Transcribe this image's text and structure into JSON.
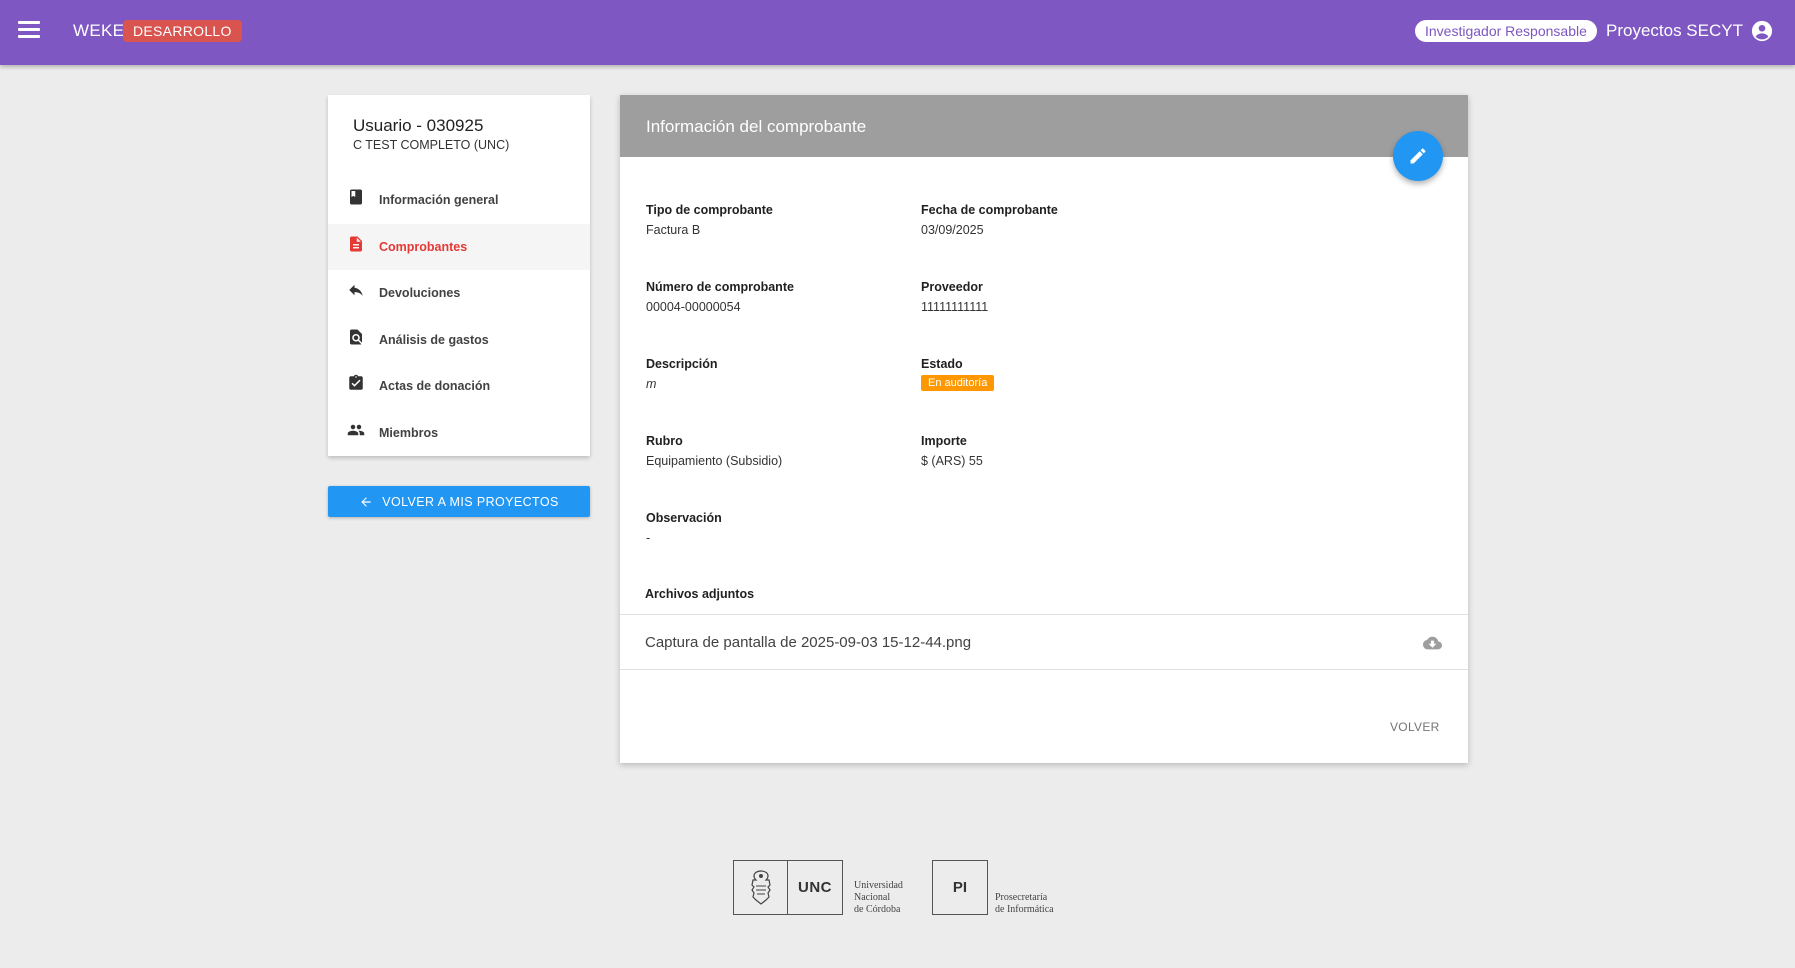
{
  "topbar": {
    "brand": "WEKE",
    "env_badge": "DESARROLLO",
    "role": "Investigador Responsable",
    "app_name": "Proyectos SECYT",
    "color": "#7e57c2"
  },
  "sidebar": {
    "title": "Usuario - 030925",
    "subtitle": "C TEST COMPLETO (UNC)",
    "items": [
      {
        "label": "Información general",
        "icon": "book-icon"
      },
      {
        "label": "Comprobantes",
        "icon": "document-icon",
        "active": true
      },
      {
        "label": "Devoluciones",
        "icon": "reply-icon"
      },
      {
        "label": "Análisis de gastos",
        "icon": "find-in-page-icon"
      },
      {
        "label": "Actas de donación",
        "icon": "assignment-check-icon"
      },
      {
        "label": "Miembros",
        "icon": "people-icon"
      }
    ],
    "back_button": "VOLVER A MIS PROYECTOS"
  },
  "main": {
    "header_title": "Información del comprobante",
    "fields": {
      "tipo": {
        "label": "Tipo de comprobante",
        "value": "Factura B"
      },
      "fecha": {
        "label": "Fecha de comprobante",
        "value": "03/09/2025"
      },
      "numero": {
        "label": "Número de comprobante",
        "value": "00004-00000054"
      },
      "proveedor": {
        "label": "Proveedor",
        "value": "11111111111"
      },
      "descripcion": {
        "label": "Descripción",
        "value": "m"
      },
      "estado": {
        "label": "Estado",
        "value": "En auditoría",
        "color": "#ff9800"
      },
      "rubro": {
        "label": "Rubro",
        "value": "Equipamiento (Subsidio)"
      },
      "importe": {
        "label": "Importe",
        "value": "$ (ARS) 55"
      },
      "observacion": {
        "label": "Observación",
        "value": "-"
      }
    },
    "attachments_title": "Archivos adjuntos",
    "attachments": [
      {
        "name": "Captura de pantalla de 2025-09-03 15-12-44.png",
        "icon": "cloud-download-icon"
      }
    ],
    "volver_label": "VOLVER"
  },
  "footer": {
    "unc_short": "UNC",
    "unc_caption": [
      "Universidad",
      "Nacional",
      "de Córdoba"
    ],
    "pi_short": "PI",
    "pi_caption": [
      "Prosecretaría",
      "de Informática"
    ]
  }
}
